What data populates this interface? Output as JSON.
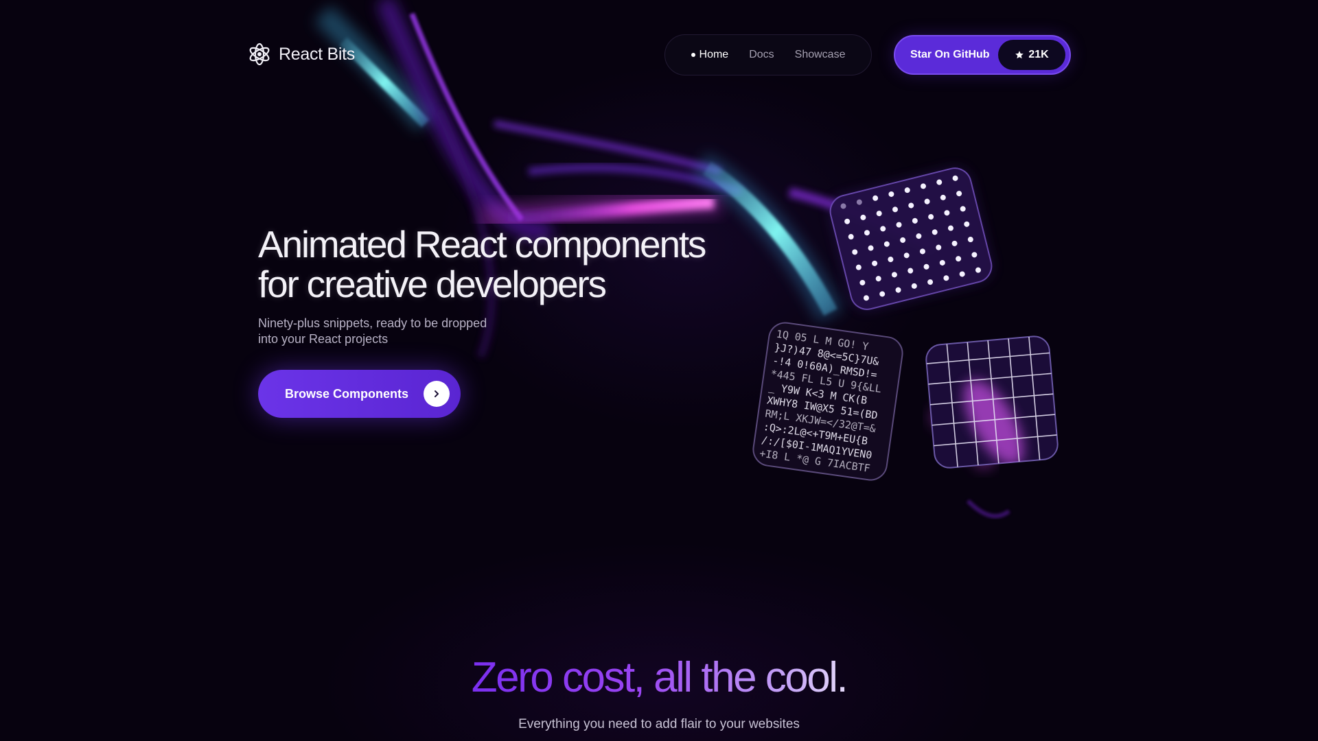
{
  "brand": {
    "name": "React Bits",
    "logo_icon": "atom-flower-icon"
  },
  "nav": {
    "items": [
      {
        "label": "Home",
        "active": true
      },
      {
        "label": "Docs",
        "active": false
      },
      {
        "label": "Showcase",
        "active": false
      }
    ]
  },
  "github": {
    "label": "Star On GitHub",
    "count": "21K",
    "icon": "star-icon"
  },
  "hero": {
    "title_line1": "Animated React components",
    "title_line2": "for creative developers",
    "subtitle_line1": "Ninety-plus snippets, ready to be dropped",
    "subtitle_line2": "into your React projects",
    "cta_label": "Browse Components",
    "cta_icon": "chevron-right-icon"
  },
  "ascii_tile": {
    "lines": [
      "1Q 05 L M GO! Y",
      "}J?)47 8@<=5C}7U&",
      "-!4 0!60A)_RMSD!=",
      "*445 FL L5 U 9{&LL",
      "_ Y9W K<3 M CK(B",
      "XWHY8 IW@X5 51=(BD",
      "RM;L XKJW=</32@T=&",
      ":Q>:2L@<+T9M+EU{B",
      "/:/[$0I-1MAQ1YVEN0",
      "+I8 L *@ G 7IACBTF"
    ]
  },
  "colors": {
    "background": "#07020f",
    "accent": "#5b2bd9",
    "accent_light": "#7a4cf0",
    "ribbon_magenta": "#e24bd8",
    "ribbon_cyan": "#6ff0ef"
  },
  "section": {
    "title": "Zero cost, all the cool.",
    "subtitle": "Everything you need to add flair to your websites"
  }
}
